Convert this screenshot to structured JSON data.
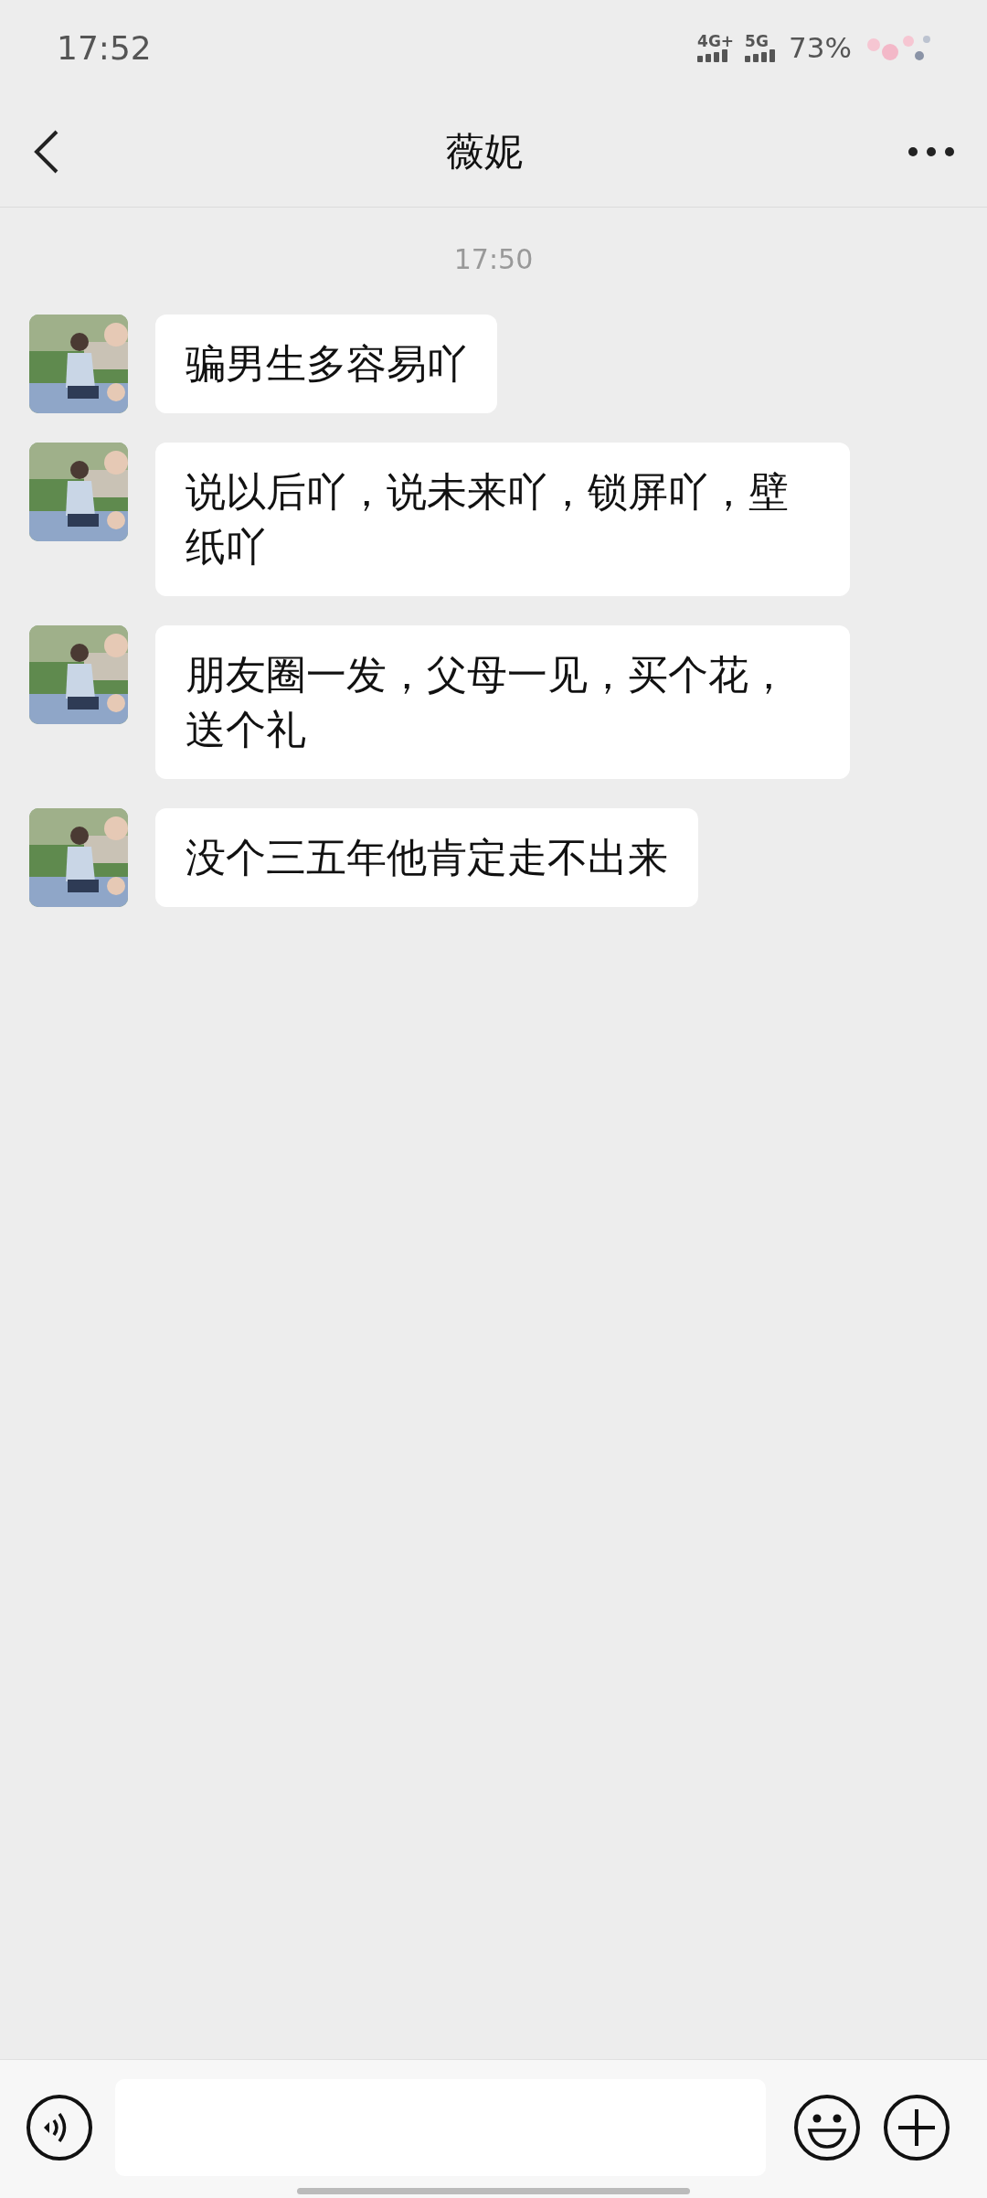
{
  "status_bar": {
    "time": "17:52",
    "network_1": "4G+",
    "network_2": "5G",
    "battery": "73%"
  },
  "nav": {
    "title": "薇妮"
  },
  "timestamp": "17:50",
  "messages": [
    {
      "text": "骗男生多容易吖"
    },
    {
      "text": "说以后吖，说未来吖，锁屏吖，壁纸吖"
    },
    {
      "text": "朋友圈一发，父母一见，买个花，送个礼"
    },
    {
      "text": "没个三五年他肯定走不出来"
    }
  ]
}
